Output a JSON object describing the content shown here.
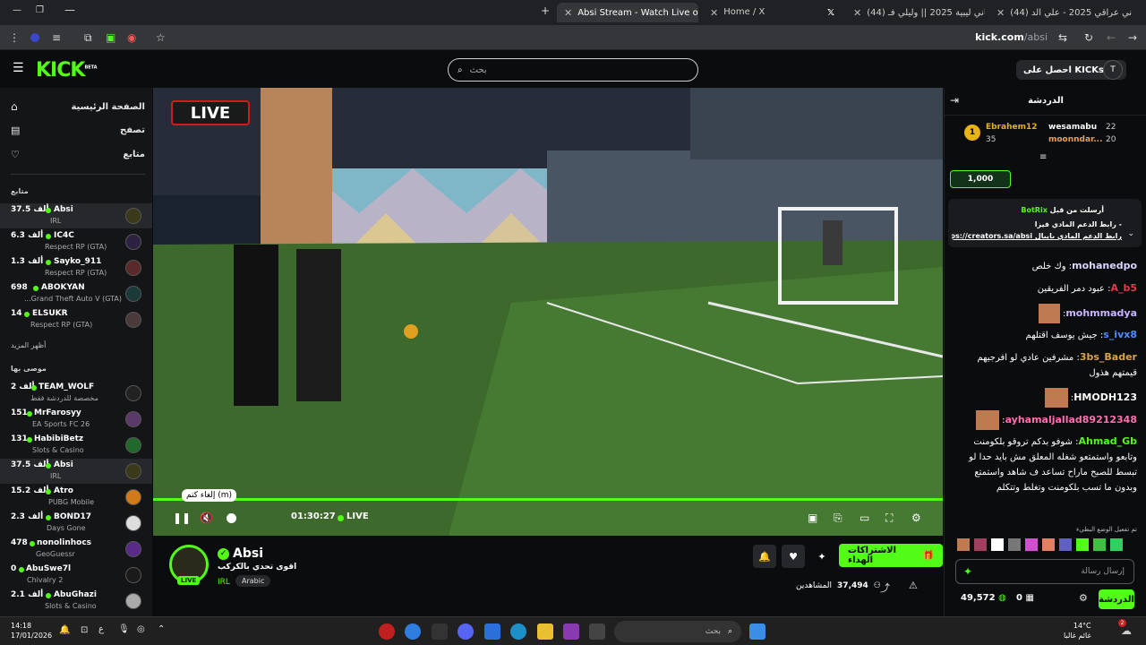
{
  "browser": {
    "tabs": [
      {
        "label": "(44) اغاني عراقي 2025 - علي الد..."
      },
      {
        "label": "(44) اغاني ليبية 2025 || وليلي فـ..."
      },
      {
        "label": "Home / X"
      },
      {
        "label": "Absi Stream - Watch Live on Ki..."
      }
    ],
    "url_domain": "kick.com",
    "url_path": "/absi"
  },
  "header": {
    "logo": "KICK",
    "logo_badge": "BETA",
    "search_placeholder": "بحث",
    "kicks_button": "احصل على KICKs",
    "avatar_initial": "T"
  },
  "sidebar": {
    "nav": [
      {
        "label": "الصفحة الرئيسية",
        "icon": "home-icon"
      },
      {
        "label": "تصفح",
        "icon": "browse-icon"
      },
      {
        "label": "متابع",
        "icon": "heart-icon"
      }
    ],
    "following_title": "متابع",
    "show_more": "أظهر المزيد",
    "recommended_title": "موصى بها",
    "following": [
      {
        "name": "Absi",
        "category": "IRL",
        "count": "37.5 ألف",
        "selected": true
      },
      {
        "name": "IC4C",
        "category": "Respect RP (GTA)",
        "count": "6.3 ألف"
      },
      {
        "name": "Sayko_911",
        "category": "Respect RP (GTA)",
        "count": "1.3 ألف"
      },
      {
        "name": "ABOKYAN",
        "category": "Grand Theft Auto V (GTA)...",
        "count": "698"
      },
      {
        "name": "ELSUKR",
        "category": "Respect RP (GTA)",
        "count": "14"
      }
    ],
    "recommended": [
      {
        "name": "TEAM_WOLF",
        "category": "مخصصة للدردشة فقط",
        "count": "2 ألف"
      },
      {
        "name": "MrFarosyy",
        "category": "EA Sports FC 26",
        "count": "151"
      },
      {
        "name": "HabibiBetz",
        "category": "Slots & Casino",
        "count": "131"
      },
      {
        "name": "Absi",
        "category": "IRL",
        "count": "37.5 ألف",
        "selected": true
      },
      {
        "name": "Atro",
        "category": "PUBG Mobile",
        "count": "15.2 ألف"
      },
      {
        "name": "BOND17",
        "category": "Days Gone",
        "count": "2.3 ألف"
      },
      {
        "name": "nonolinhocs",
        "category": "GeoGuessr",
        "count": "478"
      },
      {
        "name": "AbuSwe7l",
        "category": "Chivalry 2",
        "count": "0"
      },
      {
        "name": "AbuGhazi",
        "category": "Slots & Casino",
        "count": "2.1 ألف"
      }
    ]
  },
  "player": {
    "live_badge": "LIVE",
    "time": "01:30:27",
    "live_label": "LIVE",
    "tooltip": "إلغاء كتم (m)",
    "progress": 1.0
  },
  "stream": {
    "streamer": "Absi",
    "title": "اقوى تحدي بالكركب",
    "category": "IRL",
    "tag": "Arabic",
    "avatar_live": "LIVE",
    "viewers_label": "المشاهدين",
    "viewers": "37,494",
    "subscribe_button": "الاشتراكات الهداء"
  },
  "chat": {
    "title": "الدردشة",
    "leaderboard": [
      {
        "name": "Ebrahem12",
        "count": "35",
        "rank": "1"
      },
      {
        "name": "wesamabu",
        "count": "22"
      },
      {
        "name": "moonndar...",
        "count": "20"
      }
    ],
    "kicks_amount": "1,000",
    "pinned_by": "أرسلت من قبل",
    "pinned_user": "BotRix",
    "pinned_text": "- رابط الدعم المادي فيزا",
    "pinned_link": "رابط الدعم المادي بايبال https://creators.sa/absi",
    "messages": [
      {
        "user": "mohanedpo",
        "text": "وك خلص",
        "color": "#d6d6ff"
      },
      {
        "user": "A_b5",
        "text": "عبود دمر الفريقين",
        "color": "#e23b4a"
      },
      {
        "user": "mohmmadya",
        "text": "",
        "color": "#c9b4ff"
      },
      {
        "user": "s_ivx8",
        "text": "جيش يوسف اقتلهم",
        "color": "#4f8cff"
      },
      {
        "user": "3bs_Bader",
        "text": "مشرفين عادي لو افرجيهم قيمتهم هذول",
        "color": "#d9a24a"
      },
      {
        "user": "HMODH123",
        "text": "",
        "color": "#ffffff"
      },
      {
        "user": "ayhamaljallad89212348",
        "text": "",
        "color": "#ff6fb0"
      },
      {
        "user": "Ahmad_Gb",
        "text": "شوفو بدكم تروقو بلكومنت وتابعو واستمتعو شغله المعلق مش بايد حدا لو تبسط للصبح ماراح تساعد ف شاهد واستمتع وبدون ما تسب بلكومنت وتغلط وتتكلم",
        "color": "#53fc18"
      }
    ],
    "emote_mode_note": "تم تفعيل الوضع البطيء",
    "input_placeholder": "إرسال رسالة",
    "send_button": "الدردشة",
    "points": "49,572",
    "gift_count": "0"
  },
  "taskbar": {
    "time": "14:18",
    "date": "17/01/2026",
    "lang": "ع",
    "search_placeholder": "بحث",
    "weather_temp": "14°C",
    "weather_desc": "غائم غالبا",
    "notification_count": "2"
  }
}
